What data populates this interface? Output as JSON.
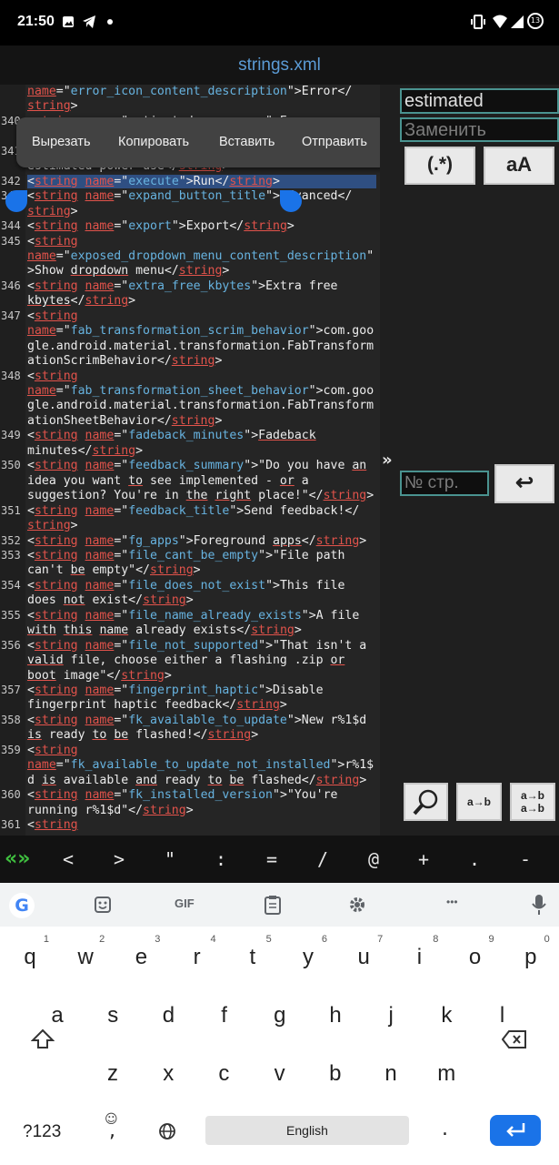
{
  "status": {
    "time": "21:50",
    "battery_level": "13"
  },
  "title": "strings.xml",
  "code_lines": [
    {
      "ln": "",
      "segs": [
        [
          "tag",
          "name"
        ],
        [
          "t",
          "=\""
        ],
        [
          "val",
          "error_icon_content_description"
        ],
        [
          "t",
          "\">Error</"
        ]
      ]
    },
    {
      "ln": "",
      "segs": [
        [
          "tag",
          "string"
        ],
        [
          "t",
          ">"
        ]
      ]
    },
    {
      "ln": "340",
      "segs": [
        [
          "t",
          "<"
        ],
        [
          "tag",
          "string"
        ],
        [
          "t",
          " "
        ],
        [
          "attr",
          "name"
        ],
        [
          "t",
          "=\"estimated_power_use\">E"
        ]
      ]
    },
    {
      "ln": "",
      "segs": [
        [
          "t",
          ""
        ]
      ]
    },
    {
      "ln": "341",
      "segs": [
        [
          "t",
          ""
        ]
      ]
    },
    {
      "ln": "",
      "segs": [
        [
          "t",
          "estimated power use</"
        ],
        [
          "tag",
          "string"
        ],
        [
          "t",
          ">"
        ]
      ]
    },
    {
      "ln": "342",
      "sel": true,
      "segs": [
        [
          "t",
          "<"
        ],
        [
          "tag",
          "string"
        ],
        [
          "t",
          " "
        ],
        [
          "attr",
          "name"
        ],
        [
          "t",
          "=\""
        ],
        [
          "val",
          "execute"
        ],
        [
          "t",
          "\">Run</"
        ],
        [
          "tag",
          "string"
        ],
        [
          "t",
          ">"
        ]
      ]
    },
    {
      "ln": "343",
      "segs": [
        [
          "t",
          "<"
        ],
        [
          "tag",
          "string"
        ],
        [
          "t",
          " "
        ],
        [
          "attr",
          "name"
        ],
        [
          "t",
          "=\""
        ],
        [
          "val",
          "expand_button_title"
        ],
        [
          "t",
          "\">Advanced</"
        ]
      ]
    },
    {
      "ln": "",
      "segs": [
        [
          "tag",
          "string"
        ],
        [
          "t",
          ">"
        ]
      ]
    },
    {
      "ln": "344",
      "segs": [
        [
          "t",
          "<"
        ],
        [
          "tag",
          "string"
        ],
        [
          "t",
          " "
        ],
        [
          "attr",
          "name"
        ],
        [
          "t",
          "=\""
        ],
        [
          "val",
          "export"
        ],
        [
          "t",
          "\">Export</"
        ],
        [
          "tag",
          "string"
        ],
        [
          "t",
          ">"
        ]
      ]
    },
    {
      "ln": "345",
      "segs": [
        [
          "t",
          "<"
        ],
        [
          "tag",
          "string"
        ]
      ]
    },
    {
      "ln": "",
      "segs": [
        [
          "attr",
          "name"
        ],
        [
          "t",
          "=\""
        ],
        [
          "val",
          "exposed_dropdown_menu_content_description"
        ],
        [
          "t",
          "\""
        ]
      ]
    },
    {
      "ln": "",
      "segs": [
        [
          "t",
          ">Show "
        ],
        [
          "ul",
          "dropdown"
        ],
        [
          "t",
          " menu</"
        ],
        [
          "tag",
          "string"
        ],
        [
          "t",
          ">"
        ]
      ]
    },
    {
      "ln": "346",
      "segs": [
        [
          "t",
          "<"
        ],
        [
          "tag",
          "string"
        ],
        [
          "t",
          " "
        ],
        [
          "attr",
          "name"
        ],
        [
          "t",
          "=\""
        ],
        [
          "val",
          "extra_free_kbytes"
        ],
        [
          "t",
          "\">Extra free"
        ]
      ]
    },
    {
      "ln": "",
      "segs": [
        [
          "ul",
          "kbytes"
        ],
        [
          "t",
          "</"
        ],
        [
          "tag",
          "string"
        ],
        [
          "t",
          ">"
        ]
      ]
    },
    {
      "ln": "347",
      "segs": [
        [
          "t",
          "<"
        ],
        [
          "tag",
          "string"
        ]
      ]
    },
    {
      "ln": "",
      "segs": [
        [
          "attr",
          "name"
        ],
        [
          "t",
          "=\""
        ],
        [
          "val",
          "fab_transformation_scrim_behavior"
        ],
        [
          "t",
          "\">com.goo"
        ]
      ]
    },
    {
      "ln": "",
      "segs": [
        [
          "t",
          "gle.android.material.transformation.FabTransform"
        ]
      ]
    },
    {
      "ln": "",
      "segs": [
        [
          "t",
          "ationScrimBehavior</"
        ],
        [
          "tag",
          "string"
        ],
        [
          "t",
          ">"
        ]
      ]
    },
    {
      "ln": "348",
      "segs": [
        [
          "t",
          "<"
        ],
        [
          "tag",
          "string"
        ]
      ]
    },
    {
      "ln": "",
      "segs": [
        [
          "attr",
          "name"
        ],
        [
          "t",
          "=\""
        ],
        [
          "val",
          "fab_transformation_sheet_behavior"
        ],
        [
          "t",
          "\">com.goo"
        ]
      ]
    },
    {
      "ln": "",
      "segs": [
        [
          "t",
          "gle.android.material.transformation.FabTransform"
        ]
      ]
    },
    {
      "ln": "",
      "segs": [
        [
          "t",
          "ationSheetBehavior</"
        ],
        [
          "tag",
          "string"
        ],
        [
          "t",
          ">"
        ]
      ]
    },
    {
      "ln": "349",
      "segs": [
        [
          "t",
          "<"
        ],
        [
          "tag",
          "string"
        ],
        [
          "t",
          " "
        ],
        [
          "attr",
          "name"
        ],
        [
          "t",
          "=\""
        ],
        [
          "val",
          "fadeback_minutes"
        ],
        [
          "t",
          "\">"
        ],
        [
          "ul",
          "Fadeback"
        ]
      ]
    },
    {
      "ln": "",
      "segs": [
        [
          "t",
          "minutes</"
        ],
        [
          "tag",
          "string"
        ],
        [
          "t",
          ">"
        ]
      ]
    },
    {
      "ln": "350",
      "segs": [
        [
          "t",
          "<"
        ],
        [
          "tag",
          "string"
        ],
        [
          "t",
          " "
        ],
        [
          "attr",
          "name"
        ],
        [
          "t",
          "=\""
        ],
        [
          "val",
          "feedback_summary"
        ],
        [
          "t",
          "\">\"Do you have "
        ],
        [
          "ul",
          "an"
        ]
      ]
    },
    {
      "ln": "",
      "segs": [
        [
          "t",
          "idea you want "
        ],
        [
          "ul",
          "to"
        ],
        [
          "t",
          " see implemented - "
        ],
        [
          "ul",
          "or"
        ],
        [
          "t",
          " a"
        ]
      ]
    },
    {
      "ln": "",
      "segs": [
        [
          "t",
          "suggestion? You're in "
        ],
        [
          "ul",
          "the"
        ],
        [
          "t",
          " "
        ],
        [
          "ul",
          "right"
        ],
        [
          "t",
          " place!\"</"
        ],
        [
          "tag",
          "string"
        ],
        [
          "t",
          ">"
        ]
      ]
    },
    {
      "ln": "351",
      "segs": [
        [
          "t",
          "<"
        ],
        [
          "tag",
          "string"
        ],
        [
          "t",
          " "
        ],
        [
          "attr",
          "name"
        ],
        [
          "t",
          "=\""
        ],
        [
          "val",
          "feedback_title"
        ],
        [
          "t",
          "\">Send feedback!</"
        ]
      ]
    },
    {
      "ln": "",
      "segs": [
        [
          "tag",
          "string"
        ],
        [
          "t",
          ">"
        ]
      ]
    },
    {
      "ln": "352",
      "segs": [
        [
          "t",
          "<"
        ],
        [
          "tag",
          "string"
        ],
        [
          "t",
          " "
        ],
        [
          "attr",
          "name"
        ],
        [
          "t",
          "=\""
        ],
        [
          "val",
          "fg_apps"
        ],
        [
          "t",
          "\">Foreground "
        ],
        [
          "ul",
          "apps"
        ],
        [
          "t",
          "</"
        ],
        [
          "tag",
          "string"
        ],
        [
          "t",
          ">"
        ]
      ]
    },
    {
      "ln": "353",
      "segs": [
        [
          "t",
          "<"
        ],
        [
          "tag",
          "string"
        ],
        [
          "t",
          " "
        ],
        [
          "attr",
          "name"
        ],
        [
          "t",
          "=\""
        ],
        [
          "val",
          "file_cant_be_empty"
        ],
        [
          "t",
          "\">\"File path"
        ]
      ]
    },
    {
      "ln": "",
      "segs": [
        [
          "t",
          "can't "
        ],
        [
          "ul",
          "be"
        ],
        [
          "t",
          " empty\"</"
        ],
        [
          "tag",
          "string"
        ],
        [
          "t",
          ">"
        ]
      ]
    },
    {
      "ln": "354",
      "segs": [
        [
          "t",
          "<"
        ],
        [
          "tag",
          "string"
        ],
        [
          "t",
          " "
        ],
        [
          "attr",
          "name"
        ],
        [
          "t",
          "=\""
        ],
        [
          "val",
          "file_does_not_exist"
        ],
        [
          "t",
          "\">This file"
        ]
      ]
    },
    {
      "ln": "",
      "segs": [
        [
          "t",
          "does "
        ],
        [
          "ul",
          "not"
        ],
        [
          "t",
          " exist</"
        ],
        [
          "tag",
          "string"
        ],
        [
          "t",
          ">"
        ]
      ]
    },
    {
      "ln": "355",
      "segs": [
        [
          "t",
          "<"
        ],
        [
          "tag",
          "string"
        ],
        [
          "t",
          " "
        ],
        [
          "attr",
          "name"
        ],
        [
          "t",
          "=\""
        ],
        [
          "val",
          "file_name_already_exists"
        ],
        [
          "t",
          "\">A file"
        ]
      ]
    },
    {
      "ln": "",
      "segs": [
        [
          "ul",
          "with"
        ],
        [
          "t",
          " "
        ],
        [
          "ul",
          "this"
        ],
        [
          "t",
          " "
        ],
        [
          "ul",
          "name"
        ],
        [
          "t",
          " already exists</"
        ],
        [
          "tag",
          "string"
        ],
        [
          "t",
          ">"
        ]
      ]
    },
    {
      "ln": "356",
      "segs": [
        [
          "t",
          "<"
        ],
        [
          "tag",
          "string"
        ],
        [
          "t",
          " "
        ],
        [
          "attr",
          "name"
        ],
        [
          "t",
          "=\""
        ],
        [
          "val",
          "file_not_supported"
        ],
        [
          "t",
          "\">\"That isn't a"
        ]
      ]
    },
    {
      "ln": "",
      "segs": [
        [
          "ul",
          "valid"
        ],
        [
          "t",
          " file, choose either a flashing .zip "
        ],
        [
          "ul",
          "or"
        ]
      ]
    },
    {
      "ln": "",
      "segs": [
        [
          "ul",
          "boot"
        ],
        [
          "t",
          " image\"</"
        ],
        [
          "tag",
          "string"
        ],
        [
          "t",
          ">"
        ]
      ]
    },
    {
      "ln": "357",
      "segs": [
        [
          "t",
          "<"
        ],
        [
          "tag",
          "string"
        ],
        [
          "t",
          " "
        ],
        [
          "attr",
          "name"
        ],
        [
          "t",
          "=\""
        ],
        [
          "val",
          "fingerprint_haptic"
        ],
        [
          "t",
          "\">Disable"
        ]
      ]
    },
    {
      "ln": "",
      "segs": [
        [
          "t",
          "fingerprint haptic feedback</"
        ],
        [
          "tag",
          "string"
        ],
        [
          "t",
          ">"
        ]
      ]
    },
    {
      "ln": "358",
      "segs": [
        [
          "t",
          "<"
        ],
        [
          "tag",
          "string"
        ],
        [
          "t",
          " "
        ],
        [
          "attr",
          "name"
        ],
        [
          "t",
          "=\""
        ],
        [
          "val",
          "fk_available_to_update"
        ],
        [
          "t",
          "\">New r%1$d"
        ]
      ]
    },
    {
      "ln": "",
      "segs": [
        [
          "ul",
          "is"
        ],
        [
          "t",
          " ready "
        ],
        [
          "ul",
          "to"
        ],
        [
          "t",
          " "
        ],
        [
          "ul",
          "be"
        ],
        [
          "t",
          " flashed!</"
        ],
        [
          "tag",
          "string"
        ],
        [
          "t",
          ">"
        ]
      ]
    },
    {
      "ln": "359",
      "segs": [
        [
          "t",
          "<"
        ],
        [
          "tag",
          "string"
        ]
      ]
    },
    {
      "ln": "",
      "segs": [
        [
          "attr",
          "name"
        ],
        [
          "t",
          "=\""
        ],
        [
          "val",
          "fk_available_to_update_not_installed"
        ],
        [
          "t",
          "\">r%1$"
        ]
      ]
    },
    {
      "ln": "",
      "segs": [
        [
          "t",
          "d "
        ],
        [
          "ul",
          "is"
        ],
        [
          "t",
          " available "
        ],
        [
          "ul",
          "and"
        ],
        [
          "t",
          " ready "
        ],
        [
          "ul",
          "to"
        ],
        [
          "t",
          " "
        ],
        [
          "ul",
          "be"
        ],
        [
          "t",
          " flashed</"
        ],
        [
          "tag",
          "string"
        ],
        [
          "t",
          ">"
        ]
      ]
    },
    {
      "ln": "360",
      "segs": [
        [
          "t",
          "<"
        ],
        [
          "tag",
          "string"
        ],
        [
          "t",
          " "
        ],
        [
          "attr",
          "name"
        ],
        [
          "t",
          "=\""
        ],
        [
          "val",
          "fk_installed_version"
        ],
        [
          "t",
          "\">\"You're"
        ]
      ]
    },
    {
      "ln": "",
      "segs": [
        [
          "t",
          "running r%1$d\"</"
        ],
        [
          "tag",
          "string"
        ],
        [
          "t",
          ">"
        ]
      ]
    },
    {
      "ln": "361",
      "segs": [
        [
          "t",
          "<"
        ],
        [
          "tag",
          "string"
        ]
      ]
    }
  ],
  "context_menu": {
    "cut": "Вырезать",
    "copy": "Копировать",
    "paste": "Вставить",
    "share": "Отправить"
  },
  "find_panel": {
    "search_value": "estimated",
    "replace_placeholder": "Заменить",
    "regex_label": "(.*)",
    "case_label": "aA",
    "expand_label": "»",
    "page_placeholder": "№ стр.",
    "go_label": "↩",
    "replace_one_label": "a→b",
    "replace_all_label_1": "a→b",
    "replace_all_label_2": "a→b"
  },
  "toolbar_keys": [
    "<",
    ">",
    "\"",
    ":",
    "=",
    "/",
    "@",
    "+",
    ".",
    "-"
  ],
  "toolbar_toggle": "«»",
  "keyboard": {
    "toolbar": {
      "gif": "GIF",
      "more": "•••"
    },
    "row1": [
      [
        "q",
        "1"
      ],
      [
        "w",
        "2"
      ],
      [
        "e",
        "3"
      ],
      [
        "r",
        "4"
      ],
      [
        "t",
        "5"
      ],
      [
        "y",
        "6"
      ],
      [
        "u",
        "7"
      ],
      [
        "i",
        "8"
      ],
      [
        "o",
        "9"
      ],
      [
        "p",
        "0"
      ]
    ],
    "row2": [
      "a",
      "s",
      "d",
      "f",
      "g",
      "h",
      "j",
      "k",
      "l"
    ],
    "row3": [
      "z",
      "x",
      "c",
      "v",
      "b",
      "n",
      "m"
    ],
    "symbols": "?123",
    "comma": ",",
    "space": "English",
    "period": "."
  },
  "colors": {
    "accent": "#1a73e8",
    "title": "#5b9bd5",
    "tag": "#e2534b",
    "value": "#67b3e0",
    "field_border": "#4a9390"
  }
}
